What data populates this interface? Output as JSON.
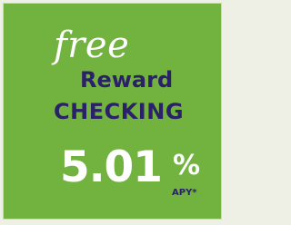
{
  "ad": {
    "free_text": "free",
    "reward_text": "Reward",
    "checking_text": "CHECKING",
    "rate_value": "5.01",
    "rate_symbol": "%",
    "rate_label": "APY*"
  },
  "colors": {
    "panel_green": "#72b340",
    "navy": "#2b2168",
    "white": "#ffffff"
  }
}
